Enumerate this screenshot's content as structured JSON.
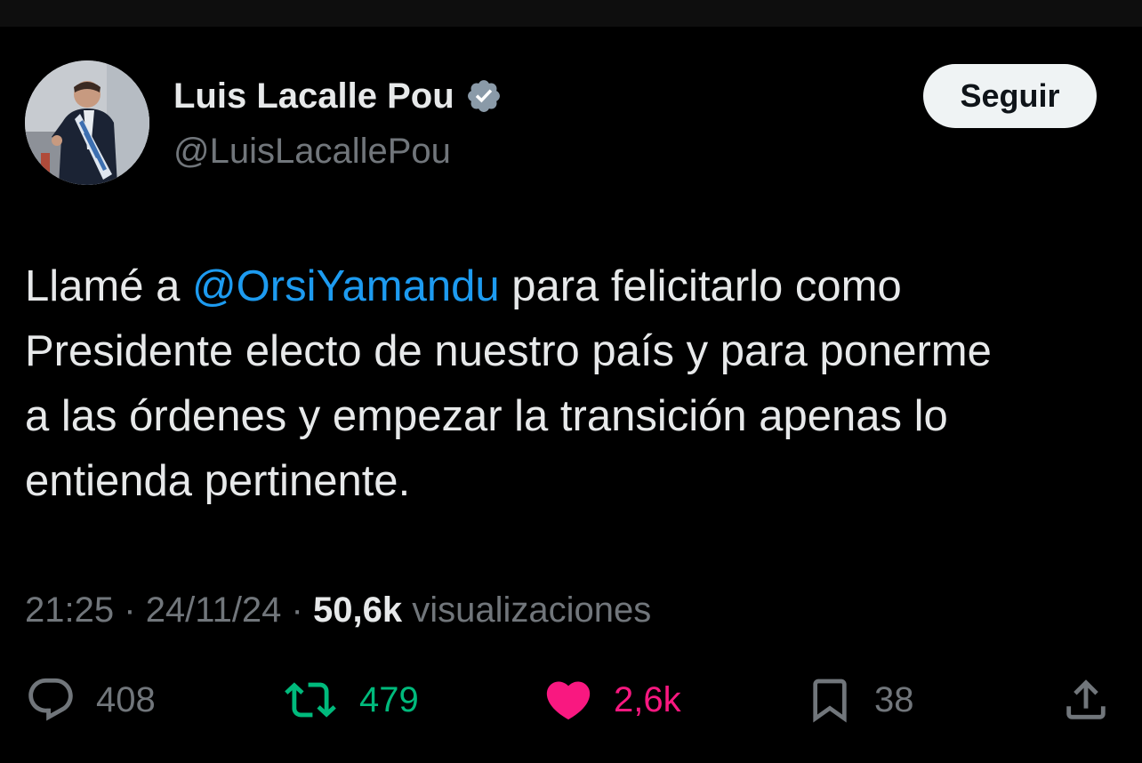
{
  "author": {
    "display_name": "Luis Lacalle Pou",
    "handle": "@LuisLacallePou",
    "verified": true,
    "verified_badge_color": "#8a9aa8"
  },
  "follow_button": {
    "label": "Seguir"
  },
  "tweet": {
    "text_before": "Llamé a ",
    "mention": "@OrsiYamandu",
    "line1_after": " para felicitarlo como",
    "line2": "Presidente electo de nuestro país y para ponerme",
    "line3": "a las órdenes y empezar la transición apenas lo",
    "line4": "entienda pertinente.",
    "mention_color": "#1d9bf0"
  },
  "meta": {
    "time": "21:25",
    "separator": "·",
    "date": "24/11/24",
    "views_count": "50,6k",
    "views_label": "visualizaciones"
  },
  "actions": {
    "replies": {
      "icon": "reply-icon",
      "count": "408"
    },
    "retweets": {
      "icon": "retweet-icon",
      "count": "479",
      "color": "#00ba7c"
    },
    "likes": {
      "icon": "heart-icon",
      "count": "2,6k",
      "color": "#f91880"
    },
    "bookmarks": {
      "icon": "bookmark-icon",
      "count": "38"
    },
    "share": {
      "icon": "share-icon"
    }
  }
}
